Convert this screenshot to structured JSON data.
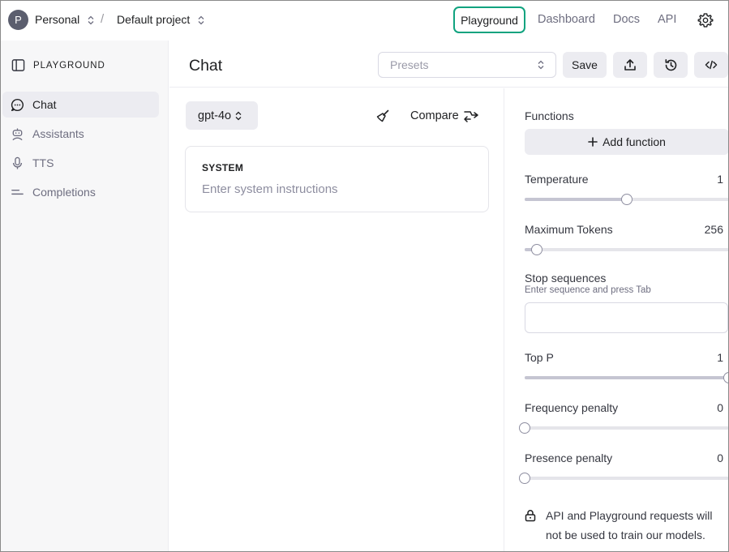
{
  "topbar": {
    "avatar_letter": "P",
    "org_name": "Personal",
    "separator": "/",
    "project_name": "Default project",
    "nav": [
      "Playground",
      "Dashboard",
      "Docs",
      "API"
    ],
    "active_nav": "Playground",
    "accent_color": "#10a37f"
  },
  "sidebar": {
    "header": "PLAYGROUND",
    "items": [
      {
        "label": "Chat",
        "icon": "chat-bubble-icon",
        "active": true
      },
      {
        "label": "Assistants",
        "icon": "robot-icon",
        "active": false
      },
      {
        "label": "TTS",
        "icon": "microphone-icon",
        "active": false
      },
      {
        "label": "Completions",
        "icon": "lines-icon",
        "active": false
      }
    ]
  },
  "header": {
    "title": "Chat",
    "presets_placeholder": "Presets",
    "save_label": "Save"
  },
  "center": {
    "model": "gpt-4o",
    "compare_label": "Compare",
    "system_label": "SYSTEM",
    "system_placeholder": "Enter system instructions"
  },
  "settings": {
    "functions_label": "Functions",
    "add_function_label": "Add function",
    "temperature": {
      "label": "Temperature",
      "value": "1",
      "fraction": 0.5
    },
    "max_tokens": {
      "label": "Maximum Tokens",
      "value": "256",
      "fraction": 0.06
    },
    "stop_sequences": {
      "label": "Stop sequences",
      "hint": "Enter sequence and press Tab"
    },
    "top_p": {
      "label": "Top P",
      "value": "1",
      "fraction": 1.0
    },
    "frequency_penalty": {
      "label": "Frequency penalty",
      "value": "0",
      "fraction": 0.0
    },
    "presence_penalty": {
      "label": "Presence penalty",
      "value": "0",
      "fraction": 0.0
    },
    "notice": "API and Playground requests will not be used to train our models."
  }
}
